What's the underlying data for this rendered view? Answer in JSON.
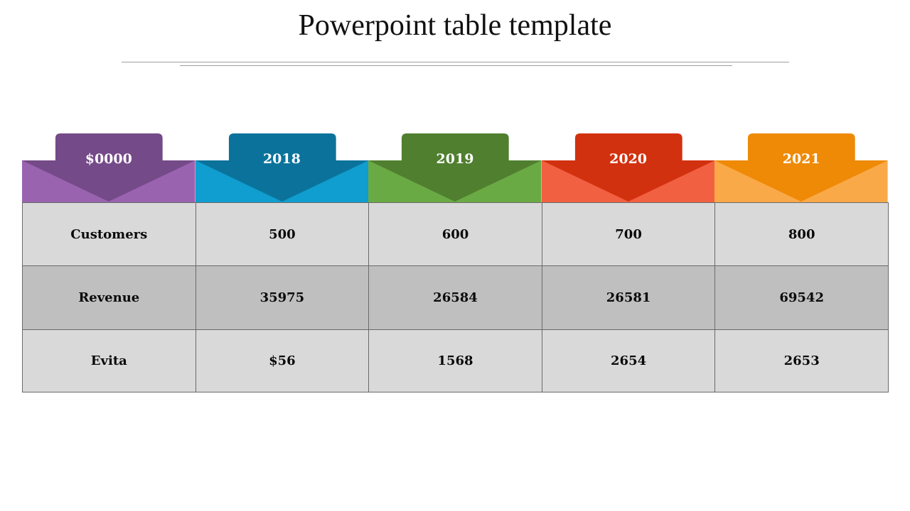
{
  "slide": {
    "title": "Powerpoint table template"
  },
  "table": {
    "headers": [
      {
        "label": "$0000",
        "colors": {
          "tab": "#744a88",
          "band": "#9a63b0"
        }
      },
      {
        "label": "2018",
        "colors": {
          "tab": "#0b739b",
          "band": "#109dcf"
        }
      },
      {
        "label": "2019",
        "colors": {
          "tab": "#507f2f",
          "band": "#6aaa44"
        }
      },
      {
        "label": "2020",
        "colors": {
          "tab": "#d2310f",
          "band": "#f26042"
        }
      },
      {
        "label": "2021",
        "colors": {
          "tab": "#ee8a06",
          "band": "#faa949"
        }
      }
    ],
    "rows": [
      {
        "label": "Customers",
        "values": [
          "500",
          "600",
          "700",
          "800"
        ]
      },
      {
        "label": "Revenue",
        "values": [
          "35975",
          "26584",
          "26581",
          "69542"
        ]
      },
      {
        "label": "Evita",
        "values": [
          "$56",
          "1568",
          "2654",
          "2653"
        ]
      }
    ]
  }
}
